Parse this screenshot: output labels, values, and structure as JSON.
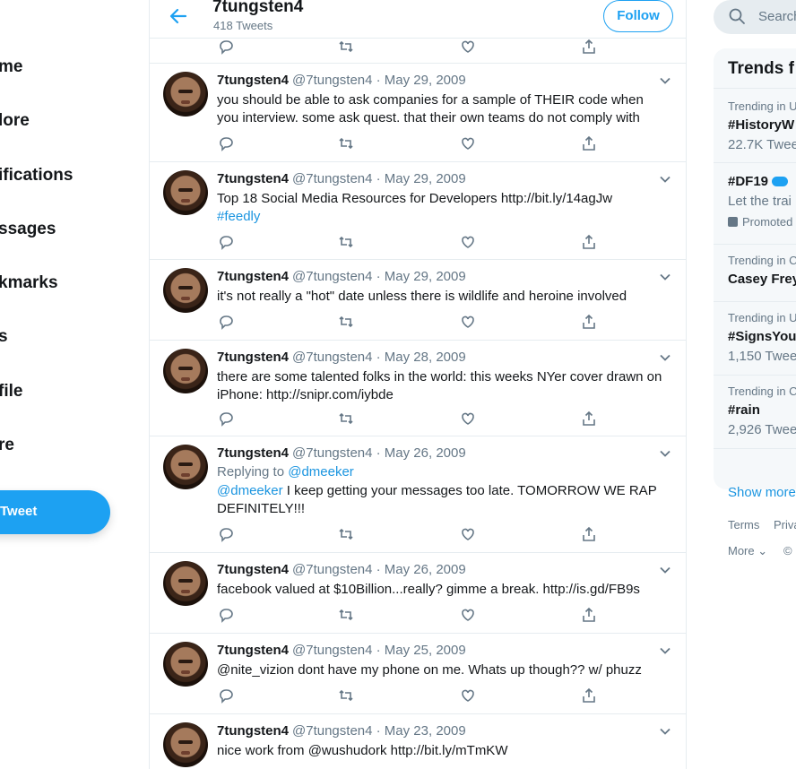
{
  "nav": {
    "items": [
      "me",
      "lore",
      "ifications",
      "ssages",
      "kmarks",
      "s",
      "file",
      "re"
    ],
    "tweet_button": "Tweet"
  },
  "header": {
    "name": "7tungsten4",
    "tweet_count": "418 Tweets",
    "follow_label": "Follow"
  },
  "tweets": [
    {
      "name": "7tungsten4",
      "meta": "@7tungsten4 · May 29, 2009",
      "text": "you should be able to ask companies for a sample of THEIR code when you interview.  some ask quest. that their own teams do not comply with"
    },
    {
      "name": "7tungsten4",
      "meta": "@7tungsten4 · May 29, 2009",
      "text": "Top 18 Social Media Resources for Developers http://bit.ly/14agJw",
      "hashtag": "#feedly"
    },
    {
      "name": "7tungsten4",
      "meta": "@7tungsten4 · May 29, 2009",
      "text": "it's not really a \"hot\" date unless there is wildlife and heroine involved"
    },
    {
      "name": "7tungsten4",
      "meta": "@7tungsten4 · May 28, 2009",
      "text": "there are some talented folks in the world: this weeks NYer cover drawn on iPhone: http://snipr.com/iybde"
    },
    {
      "name": "7tungsten4",
      "meta": "@7tungsten4 · May 26, 2009",
      "replying_prefix": "Replying to ",
      "replying_to": "@dmeeker",
      "mention": "@dmeeker",
      "text": " I keep getting your messages too late.  TOMORROW WE RAP DEFINITELY!!!"
    },
    {
      "name": "7tungsten4",
      "meta": "@7tungsten4 · May 26, 2009",
      "text": "facebook valued at $10Billion...really? gimme a break. http://is.gd/FB9s"
    },
    {
      "name": "7tungsten4",
      "meta": "@7tungsten4 · May 25, 2009",
      "text": "@nite_vizion dont have my phone on me.  Whats up though?? w/ phuzz"
    },
    {
      "name": "7tungsten4",
      "meta": "@7tungsten4 · May 23, 2009",
      "text": "nice work from @wushudork  http://bit.ly/mTmKW"
    }
  ],
  "search": {
    "placeholder": "Search"
  },
  "trends": {
    "title": "Trends f",
    "items": [
      {
        "context": "Trending in U",
        "name": "#HistoryW",
        "count": "22.7K Twee"
      },
      {
        "context": "",
        "name": "#DF19",
        "count": "Let the trai",
        "promoted": "Promoted"
      },
      {
        "context": "Trending in C",
        "name": "Casey Frey",
        "count": ""
      },
      {
        "context": "Trending in U",
        "name": "#SignsYou",
        "count": "1,150 Twee"
      },
      {
        "context": "Trending in C",
        "name": "#rain",
        "count": "2,926 Twee"
      }
    ],
    "show_more": "Show more"
  },
  "footer": {
    "terms": "Terms",
    "privacy": "Priva",
    "more": "More",
    "copyright": "©"
  },
  "colors": {
    "accent": "#1da1f2",
    "link": "#1b95e0",
    "muted": "#657786"
  }
}
